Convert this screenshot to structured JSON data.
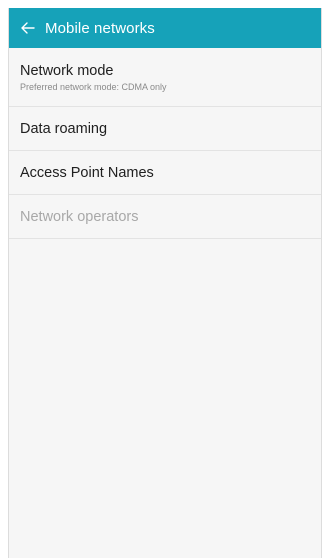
{
  "appbar": {
    "title": "Mobile networks",
    "background": "#16a2b9",
    "back_icon": "arrow-left-icon"
  },
  "items": [
    {
      "label": "Network mode",
      "summary": "Preferred network mode: CDMA only",
      "enabled": true
    },
    {
      "label": "Data roaming",
      "enabled": true
    },
    {
      "label": "Access Point Names",
      "enabled": true
    },
    {
      "label": "Network operators",
      "enabled": false
    }
  ]
}
